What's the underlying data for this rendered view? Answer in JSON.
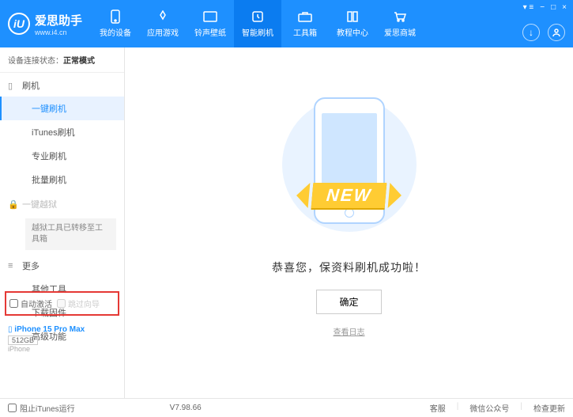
{
  "brand": {
    "name": "爱思助手",
    "url": "www.i4.cn",
    "logo_letter": "iU"
  },
  "nav": [
    {
      "label": "我的设备"
    },
    {
      "label": "应用游戏"
    },
    {
      "label": "铃声壁纸"
    },
    {
      "label": "智能刷机"
    },
    {
      "label": "工具箱"
    },
    {
      "label": "教程中心"
    },
    {
      "label": "爱思商城"
    }
  ],
  "status": {
    "prefix": "设备连接状态：",
    "value": "正常模式"
  },
  "sidebar": {
    "flash_section": "刷机",
    "items": [
      {
        "label": "一键刷机"
      },
      {
        "label": "iTunes刷机"
      },
      {
        "label": "专业刷机"
      },
      {
        "label": "批量刷机"
      }
    ],
    "jailbreak_section": "一键越狱",
    "jailbreak_note": "越狱工具已转移至工具箱",
    "more_section": "更多",
    "more_items": [
      {
        "label": "其他工具"
      },
      {
        "label": "下载固件"
      },
      {
        "label": "高级功能"
      }
    ],
    "checkbox1": "自动激活",
    "checkbox2": "跳过向导"
  },
  "device": {
    "name": "iPhone 15 Pro Max",
    "capacity": "512GB",
    "type": "iPhone"
  },
  "main": {
    "banner": "NEW",
    "success": "恭喜您，保资料刷机成功啦！",
    "ok": "确定",
    "log": "查看日志"
  },
  "footer": {
    "block_itunes": "阻止iTunes运行",
    "version": "V7.98.66",
    "links": [
      "客服",
      "微信公众号",
      "检查更新"
    ]
  }
}
